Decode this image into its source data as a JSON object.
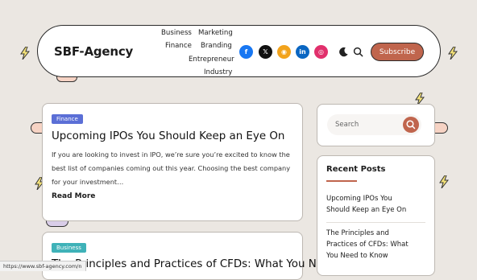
{
  "brand": {
    "logo_text": "SBF-Agency",
    "accent": "#c0654d"
  },
  "nav": {
    "business": "Business",
    "marketing": "Marketing",
    "finance": "Finance",
    "branding": "Branding",
    "entrepreneur": "Entrepreneur",
    "industry": "Industry"
  },
  "social": {
    "facebook": {
      "glyph": "f",
      "color": "#1877f2",
      "icon": "facebook-icon"
    },
    "x": {
      "glyph": "𝕏",
      "color": "#111111",
      "icon": "x-icon"
    },
    "rss": {
      "glyph": "◉",
      "color": "#f2a31c",
      "icon": "rss-icon"
    },
    "linkedin": {
      "glyph": "in",
      "color": "#0a66c2",
      "icon": "linkedin-icon"
    },
    "instagram": {
      "glyph": "◎",
      "color": "#e1306c",
      "icon": "instagram-icon"
    }
  },
  "tools": {
    "theme_icon": "moon-icon",
    "search_icon": "search-icon"
  },
  "subscribe_label": "Subscribe",
  "posts": [
    {
      "category": "Finance",
      "category_color": "#5b6fd6",
      "title": "Upcoming IPOs You Should Keep an Eye On",
      "excerpt": "If you are looking to invest in IPO, we’re sure you’re excited to know the best list of companies coming out this year. Choosing the best company for your investment…",
      "read_more": "Read More"
    },
    {
      "category": "Business",
      "category_color": "#3fb2b8",
      "title": "The Principles and Practices of CFDs: What You Need"
    }
  ],
  "sidebar": {
    "search_placeholder": "Search",
    "recent_title": "Recent Posts",
    "recent_posts": [
      "Upcoming IPOs You Should Keep an Eye On",
      "The Principles and Practices of CFDs: What You Need to Know"
    ]
  },
  "status_url": "https://www.sbf-agency.com/n"
}
